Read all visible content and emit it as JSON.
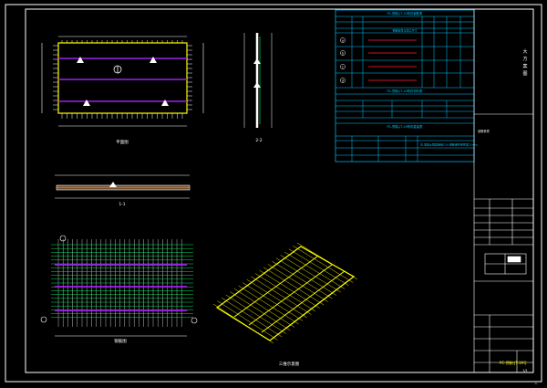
{
  "drawing": {
    "title_block": {
      "drawing_number": "PC-预制-JT-19号",
      "side_chars": [
        "大",
        "方",
        "案",
        "图"
      ],
      "sheet_no": "1/1",
      "rev_label": "工"
    },
    "views": {
      "plan": "平面图",
      "section_a": "1-1",
      "section_b": "2-2",
      "rebar": "钢筋图",
      "axonometric": "三维示意图"
    },
    "tables": {
      "rebar_header": "PC-预制-JT-19构件钢筋表",
      "rebar_subheader": "钢筋编号与加工尺寸",
      "qty_header": "PC-预制-JT-19构件材料表",
      "weight_header": "PC-预制-JT-19构件重量表",
      "mark_a": "a",
      "mark_b": "b",
      "mark_c": "c",
      "mark_d": "d",
      "notes_label": "说明事项",
      "remark": "注:混凝土强度等级C30,钢筋保护层厚度15mm."
    },
    "colors": {
      "background": "#000000",
      "linework": "#ffffff",
      "table": "#00c8ff",
      "rebar": "#00ff66",
      "dimension": "#ffff00",
      "hidden": "#a020f0",
      "accent": "#ff2040"
    }
  }
}
